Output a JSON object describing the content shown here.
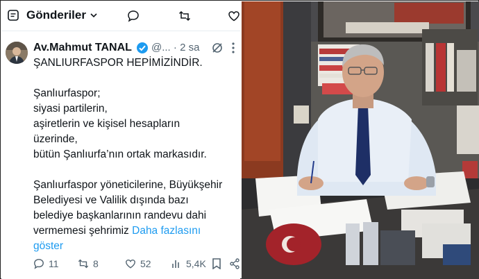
{
  "header": {
    "title": "Gönderiler",
    "dropdown_icon": "chevron-down-icon",
    "tab_icons": [
      "reply-icon",
      "retweet-icon",
      "heart-icon"
    ]
  },
  "tweet": {
    "author_name": "Av.Mahmut TANAL",
    "handle": "@...",
    "time": "· 2 sa",
    "lines": [
      "ŞANLIURFASPOR HEPİMİZİNDİR.",
      "",
      "Şanlıurfaspor;",
      "siyasi partilerin,",
      "aşiretlerin ve kişisel hesapların",
      "üzerinde,",
      "bütün Şanlıurfa’nın ortak markasıdır.",
      "",
      "Şanlıurfaspor yöneticilerine, Büyükşehir",
      "Belediyesi ve Valilik dışında bazı",
      "belediye başkanlarının randevu dahi",
      "vermemesi şehrimiz"
    ],
    "show_more": "Daha fazlasını",
    "show_more_2": "göster"
  },
  "actions": {
    "replies": "11",
    "retweets": "8",
    "likes": "52",
    "views": "5,4K"
  },
  "colors": {
    "link": "#1d9bf0",
    "muted": "#536471",
    "verified": "#1d9bf0"
  }
}
